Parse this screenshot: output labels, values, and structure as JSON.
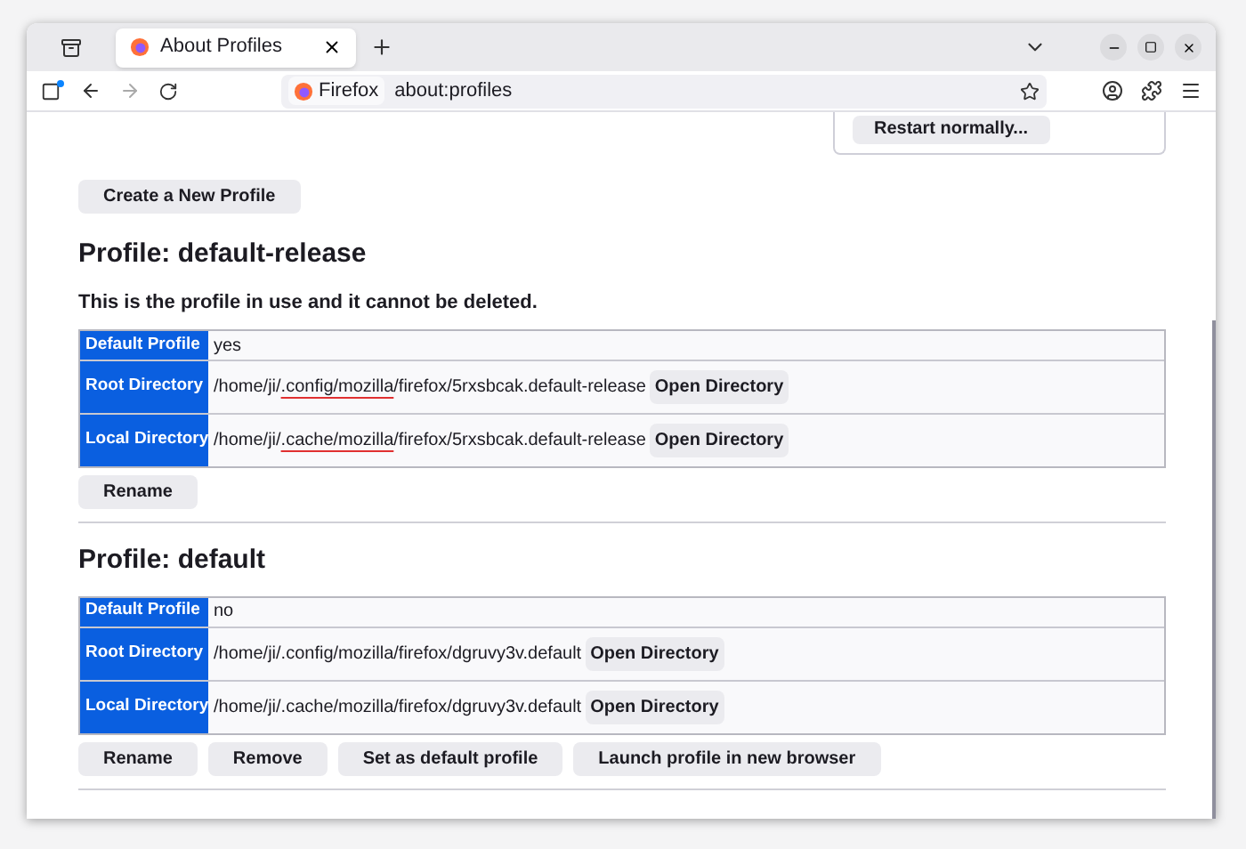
{
  "tabs": [
    {
      "title": "About Profiles",
      "selected": true
    }
  ],
  "address_bar": {
    "identity": "Firefox",
    "url": "about:profiles"
  },
  "restart_panel": {
    "button": "Restart normally..."
  },
  "create_button": "Create a New Profile",
  "profiles": [
    {
      "heading": "Profile: default-release",
      "note": "This is the profile in use and it cannot be deleted.",
      "rows": [
        {
          "label": "Default Profile",
          "kind": "value",
          "parts": [
            {
              "text": "yes"
            }
          ]
        },
        {
          "label": "Root Directory",
          "kind": "directory",
          "parts": [
            {
              "text": "/home/ji/"
            },
            {
              "text": ".config/mozilla",
              "underlined": true
            },
            {
              "text": "/firefox/5rxsbcak.default-release"
            }
          ],
          "button": "Open Directory"
        },
        {
          "label": "Local Directory",
          "kind": "directory",
          "parts": [
            {
              "text": "/home/ji/"
            },
            {
              "text": ".cache/mozilla",
              "underlined": true
            },
            {
              "text": "/firefox/5rxsbcak.default-release"
            }
          ],
          "button": "Open Directory"
        }
      ],
      "buttons": [
        "Rename"
      ]
    },
    {
      "heading": "Profile: default",
      "rows": [
        {
          "label": "Default Profile",
          "kind": "value",
          "parts": [
            {
              "text": "no"
            }
          ]
        },
        {
          "label": "Root Directory",
          "kind": "directory",
          "parts": [
            {
              "text": "/home/ji/.config/mozilla/firefox/dgruvy3v.default"
            }
          ],
          "button": "Open Directory"
        },
        {
          "label": "Local Directory",
          "kind": "directory",
          "parts": [
            {
              "text": "/home/ji/.cache/mozilla/firefox/dgruvy3v.default"
            }
          ],
          "button": "Open Directory"
        }
      ],
      "buttons": [
        "Rename",
        "Remove",
        "Set as default profile",
        "Launch profile in new browser"
      ]
    }
  ]
}
